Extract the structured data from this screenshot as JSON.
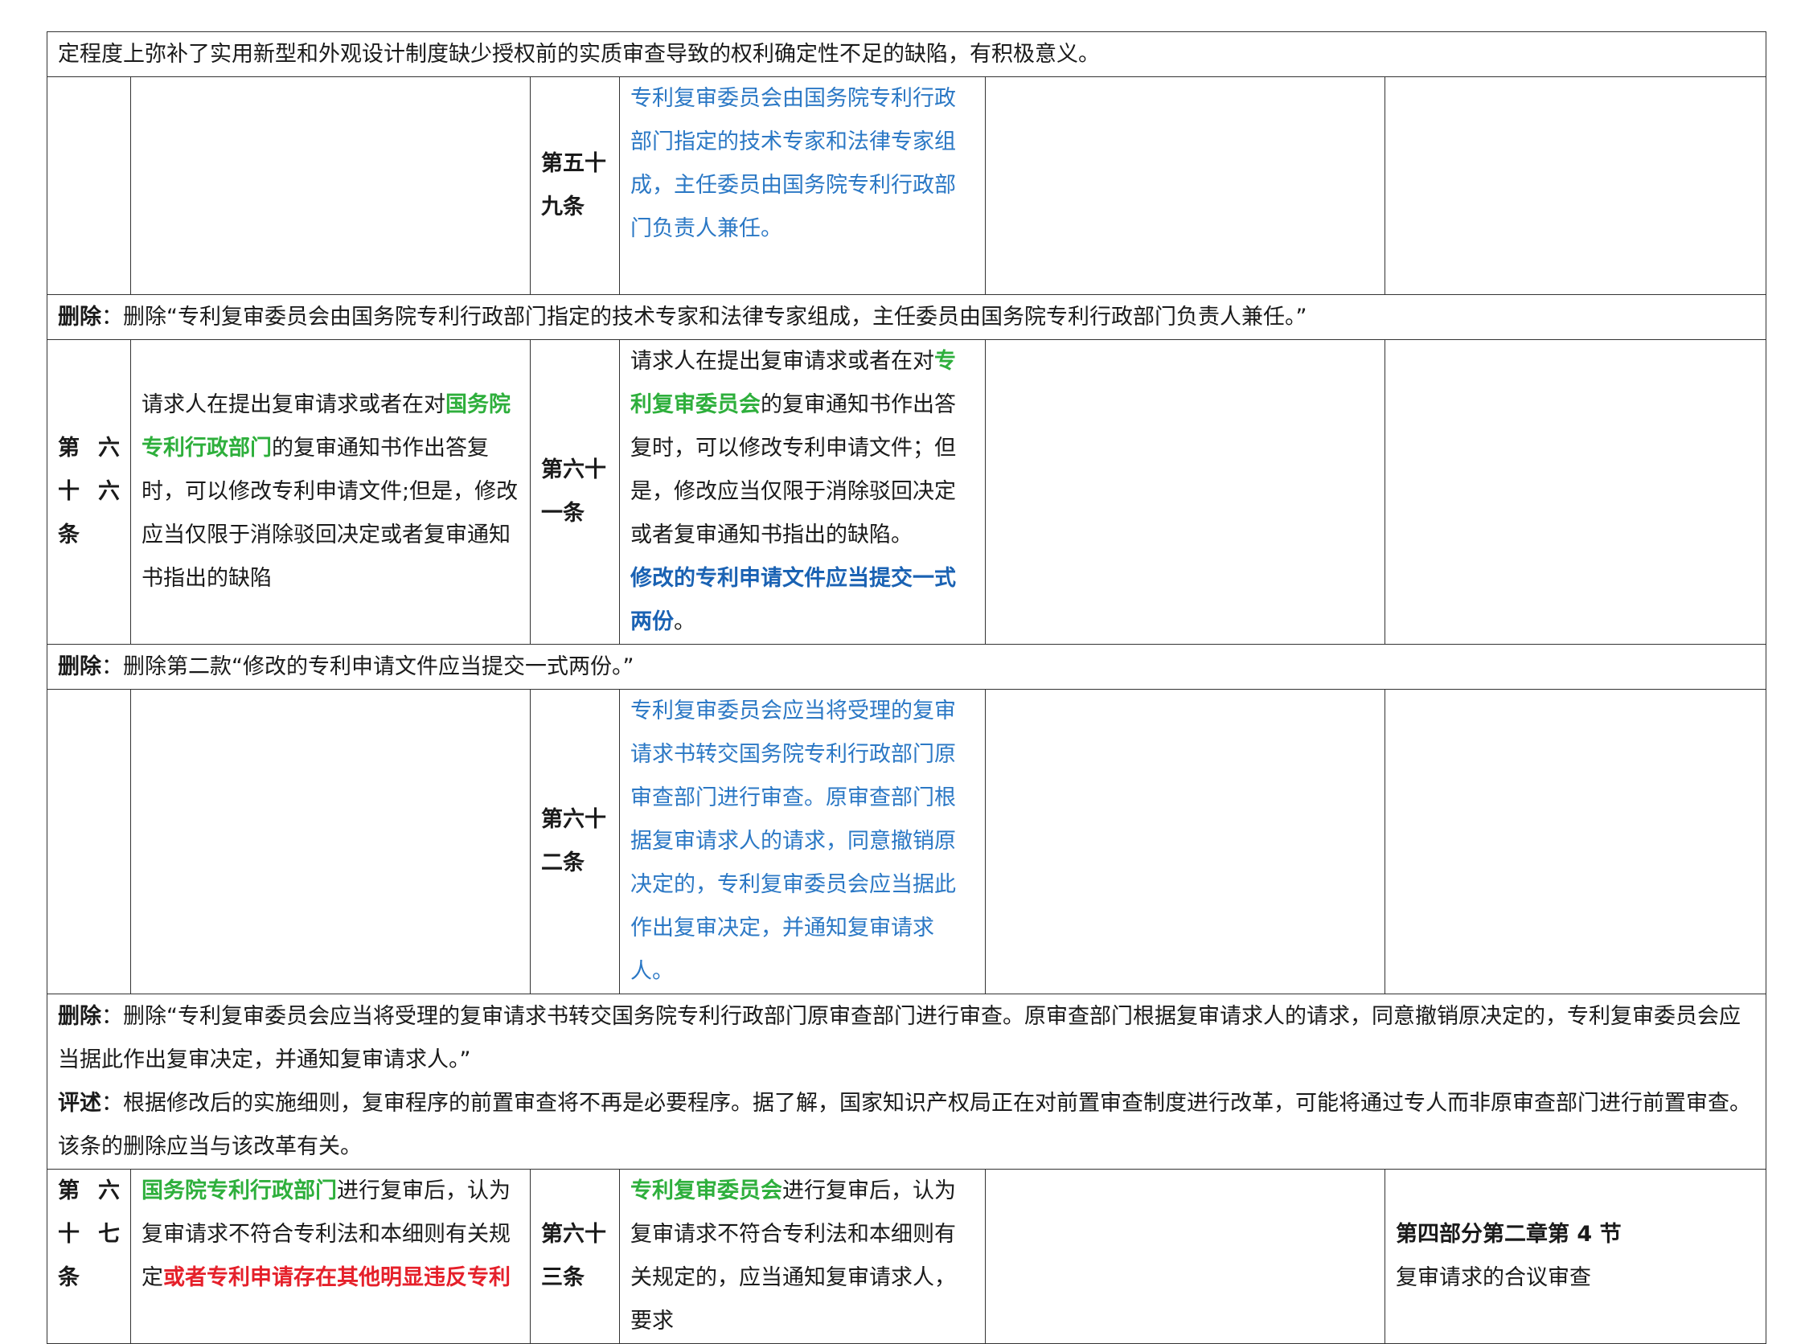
{
  "top_note": "定程度上弥补了实用新型和外观设计制度缺少授权前的实质审查导致的权利确定性不足的缺陷，有积极意义。",
  "row59": {
    "new_article": "第五十九条",
    "new_article_l1": "第五十",
    "new_article_l2": "九条",
    "new_text": "专利复审委员会由国务院专利行政部门指定的技术专家和法律专家组成，主任委员由国务院专利行政部门负责人兼任。"
  },
  "note59": {
    "label": "删除",
    "text": "：删除“专利复审委员会由国务院专利行政部门指定的技术专家和法律专家组成，主任委员由国务院专利行政部门负责人兼任。”"
  },
  "row66": {
    "old_article_l1": "第 六",
    "old_article_l2": "十 六",
    "old_article_l3": "条",
    "old_text_1": "请求人在提出复审请求或者在对",
    "old_text_green": "国务院专利行政部门",
    "old_text_2": "的复审通知书作出答复时，可以修改专利申请文件;但是，修改应当仅限于消除驳回决定或者复审通知书指出的缺陷",
    "new_article_l1": "第六十",
    "new_article_l2": "一条",
    "new_text_1": "请求人在提出复审请求或者在对",
    "new_text_green": "专利复审委员会",
    "new_text_2": "的复审通知书作出答复时，可以修改专利申请文件；但是，修改应当仅限于消除驳回决定或者复审通知书指出的缺陷。",
    "new_text_bold": "修改的专利申请文件应当提交一式两份",
    "new_text_end": "。"
  },
  "note61": {
    "label": "删除",
    "text": "：删除第二款“修改的专利申请文件应当提交一式两份。”"
  },
  "row62": {
    "new_article_l1": "第六十",
    "new_article_l2": "二条",
    "new_text": "专利复审委员会应当将受理的复审请求书转交国务院专利行政部门原审查部门进行审查。原审查部门根据复审请求人的请求，同意撤销原决定的，专利复审委员会应当据此作出复审决定，并通知复审请求人。"
  },
  "note62": {
    "label1": "删除",
    "text1": "：删除“专利复审委员会应当将受理的复审请求书转交国务院专利行政部门原审查部门进行审查。原审查部门根据复审请求人的请求，同意撤销原决定的，专利复审委员会应当据此作出复审决定，并通知复审请求人。”",
    "label2": "评述",
    "text2": "：根据修改后的实施细则，复审程序的前置审查将不再是必要程序。据了解，国家知识产权局正在对前置审查制度进行改革，可能将通过专人而非原审查部门进行前置审查。该条的删除应当与该改革有关。"
  },
  "row67": {
    "old_article_l1": "第 六",
    "old_article_l2": "十 七",
    "old_article_l3": "条",
    "old_text_green": "国务院专利行政部门",
    "old_text_1": "进行复审后，认为复审请求不符合专利法和本细则有关规定",
    "old_text_red": "或者专利申请存在其他明显违反专利",
    "new_article_l1": "第六十",
    "new_article_l2": "三条",
    "new_text_green": "专利复审委员会",
    "new_text_1": "进行复审后，认为复审请求不符合专利法和本细则有关规定的，应当通知复审请求人，要求",
    "guide_title": "第四部分第二章第 4 节",
    "guide_text": "复审请求的合议审查"
  },
  "colors": {
    "blue_text": "#2b78c5",
    "green_text": "#2eaf3c",
    "red_text": "#e5202a",
    "border": "#333333"
  }
}
